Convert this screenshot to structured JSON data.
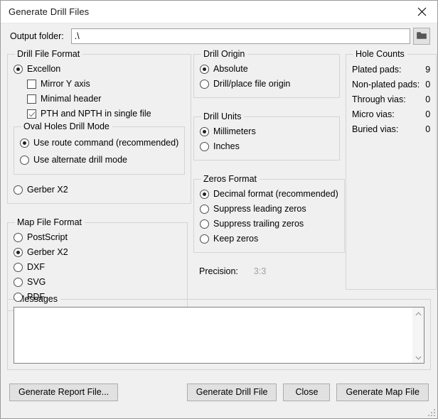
{
  "window": {
    "title": "Generate Drill Files",
    "close_icon": "close-icon"
  },
  "output": {
    "label": "Output folder:",
    "value": ".\\",
    "placeholder": "",
    "browse_icon": "folder-icon"
  },
  "drill_file_format": {
    "legend": "Drill File Format",
    "options": [
      {
        "label": "Excellon",
        "selected": true
      },
      {
        "label": "Gerber X2",
        "selected": false
      }
    ],
    "checkboxes": [
      {
        "label": "Mirror Y axis",
        "checked": false
      },
      {
        "label": "Minimal header",
        "checked": false
      },
      {
        "label": "PTH and NPTH in single file",
        "checked": true
      }
    ],
    "oval_holes": {
      "legend": "Oval Holes Drill Mode",
      "options": [
        {
          "label": "Use route command (recommended)",
          "selected": true
        },
        {
          "label": "Use alternate drill mode",
          "selected": false
        }
      ]
    }
  },
  "map_file_format": {
    "legend": "Map File Format",
    "options": [
      {
        "label": "PostScript",
        "selected": false
      },
      {
        "label": "Gerber X2",
        "selected": true
      },
      {
        "label": "DXF",
        "selected": false
      },
      {
        "label": "SVG",
        "selected": false
      },
      {
        "label": "PDF",
        "selected": false
      }
    ]
  },
  "drill_origin": {
    "legend": "Drill Origin",
    "options": [
      {
        "label": "Absolute",
        "selected": true
      },
      {
        "label": "Drill/place file origin",
        "selected": false
      }
    ]
  },
  "drill_units": {
    "legend": "Drill Units",
    "options": [
      {
        "label": "Millimeters",
        "selected": true
      },
      {
        "label": "Inches",
        "selected": false
      }
    ]
  },
  "zeros_format": {
    "legend": "Zeros Format",
    "options": [
      {
        "label": "Decimal format (recommended)",
        "selected": true
      },
      {
        "label": "Suppress leading zeros",
        "selected": false
      },
      {
        "label": "Suppress trailing zeros",
        "selected": false
      },
      {
        "label": "Keep zeros",
        "selected": false
      }
    ]
  },
  "precision": {
    "label": "Precision:",
    "value": "3:3",
    "disabled_color": "#a0a0a0"
  },
  "hole_counts": {
    "legend": "Hole Counts",
    "rows": [
      {
        "label": "Plated pads:",
        "value": "9"
      },
      {
        "label": "Non-plated pads:",
        "value": "0"
      },
      {
        "label": "Through vias:",
        "value": "0"
      },
      {
        "label": "Micro vias:",
        "value": "0"
      },
      {
        "label": "Buried vias:",
        "value": "0"
      }
    ]
  },
  "messages": {
    "legend": "Messages",
    "value": "",
    "placeholder": "",
    "scroll_up_icon": "chevron-up-icon",
    "scroll_down_icon": "chevron-down-icon"
  },
  "footer": {
    "generate_report": "Generate Report File...",
    "generate_drill": "Generate Drill File",
    "close": "Close",
    "generate_map": "Generate Map File"
  }
}
